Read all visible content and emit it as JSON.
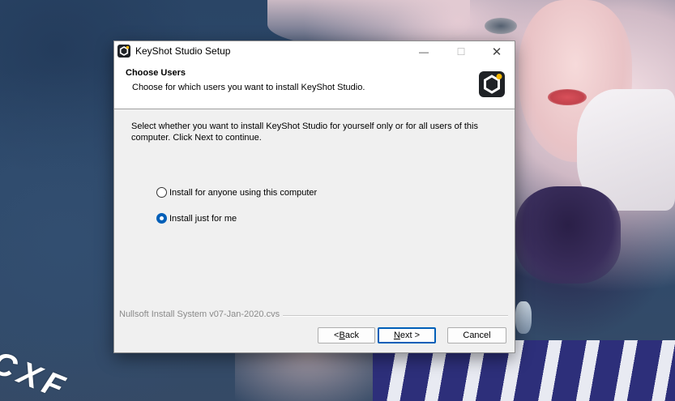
{
  "wallpaper": {
    "watermark": "CXF"
  },
  "window": {
    "title": "KeyShot Studio Setup",
    "controls": {
      "minimize": "—",
      "maximize": "☐",
      "close": "✕"
    }
  },
  "header": {
    "title": "Choose Users",
    "subtitle": "Choose for which users you want to install KeyShot Studio."
  },
  "body": {
    "intro": "Select whether you want to install KeyShot Studio for yourself only or for all users of this computer. Click Next to continue.",
    "options": [
      {
        "label": "Install for anyone using this computer",
        "selected": false
      },
      {
        "label": "Install just for me",
        "selected": true
      }
    ]
  },
  "footer": {
    "branding": "Nullsoft Install System v07-Jan-2020.cvs",
    "back_prefix": "< ",
    "back_key": "B",
    "back_rest": "ack",
    "next_prefix": "",
    "next_key": "N",
    "next_rest": "ext >",
    "cancel_label": "Cancel"
  },
  "colors": {
    "accent": "#005fb8",
    "annotation_arrow": "#e0202a"
  }
}
